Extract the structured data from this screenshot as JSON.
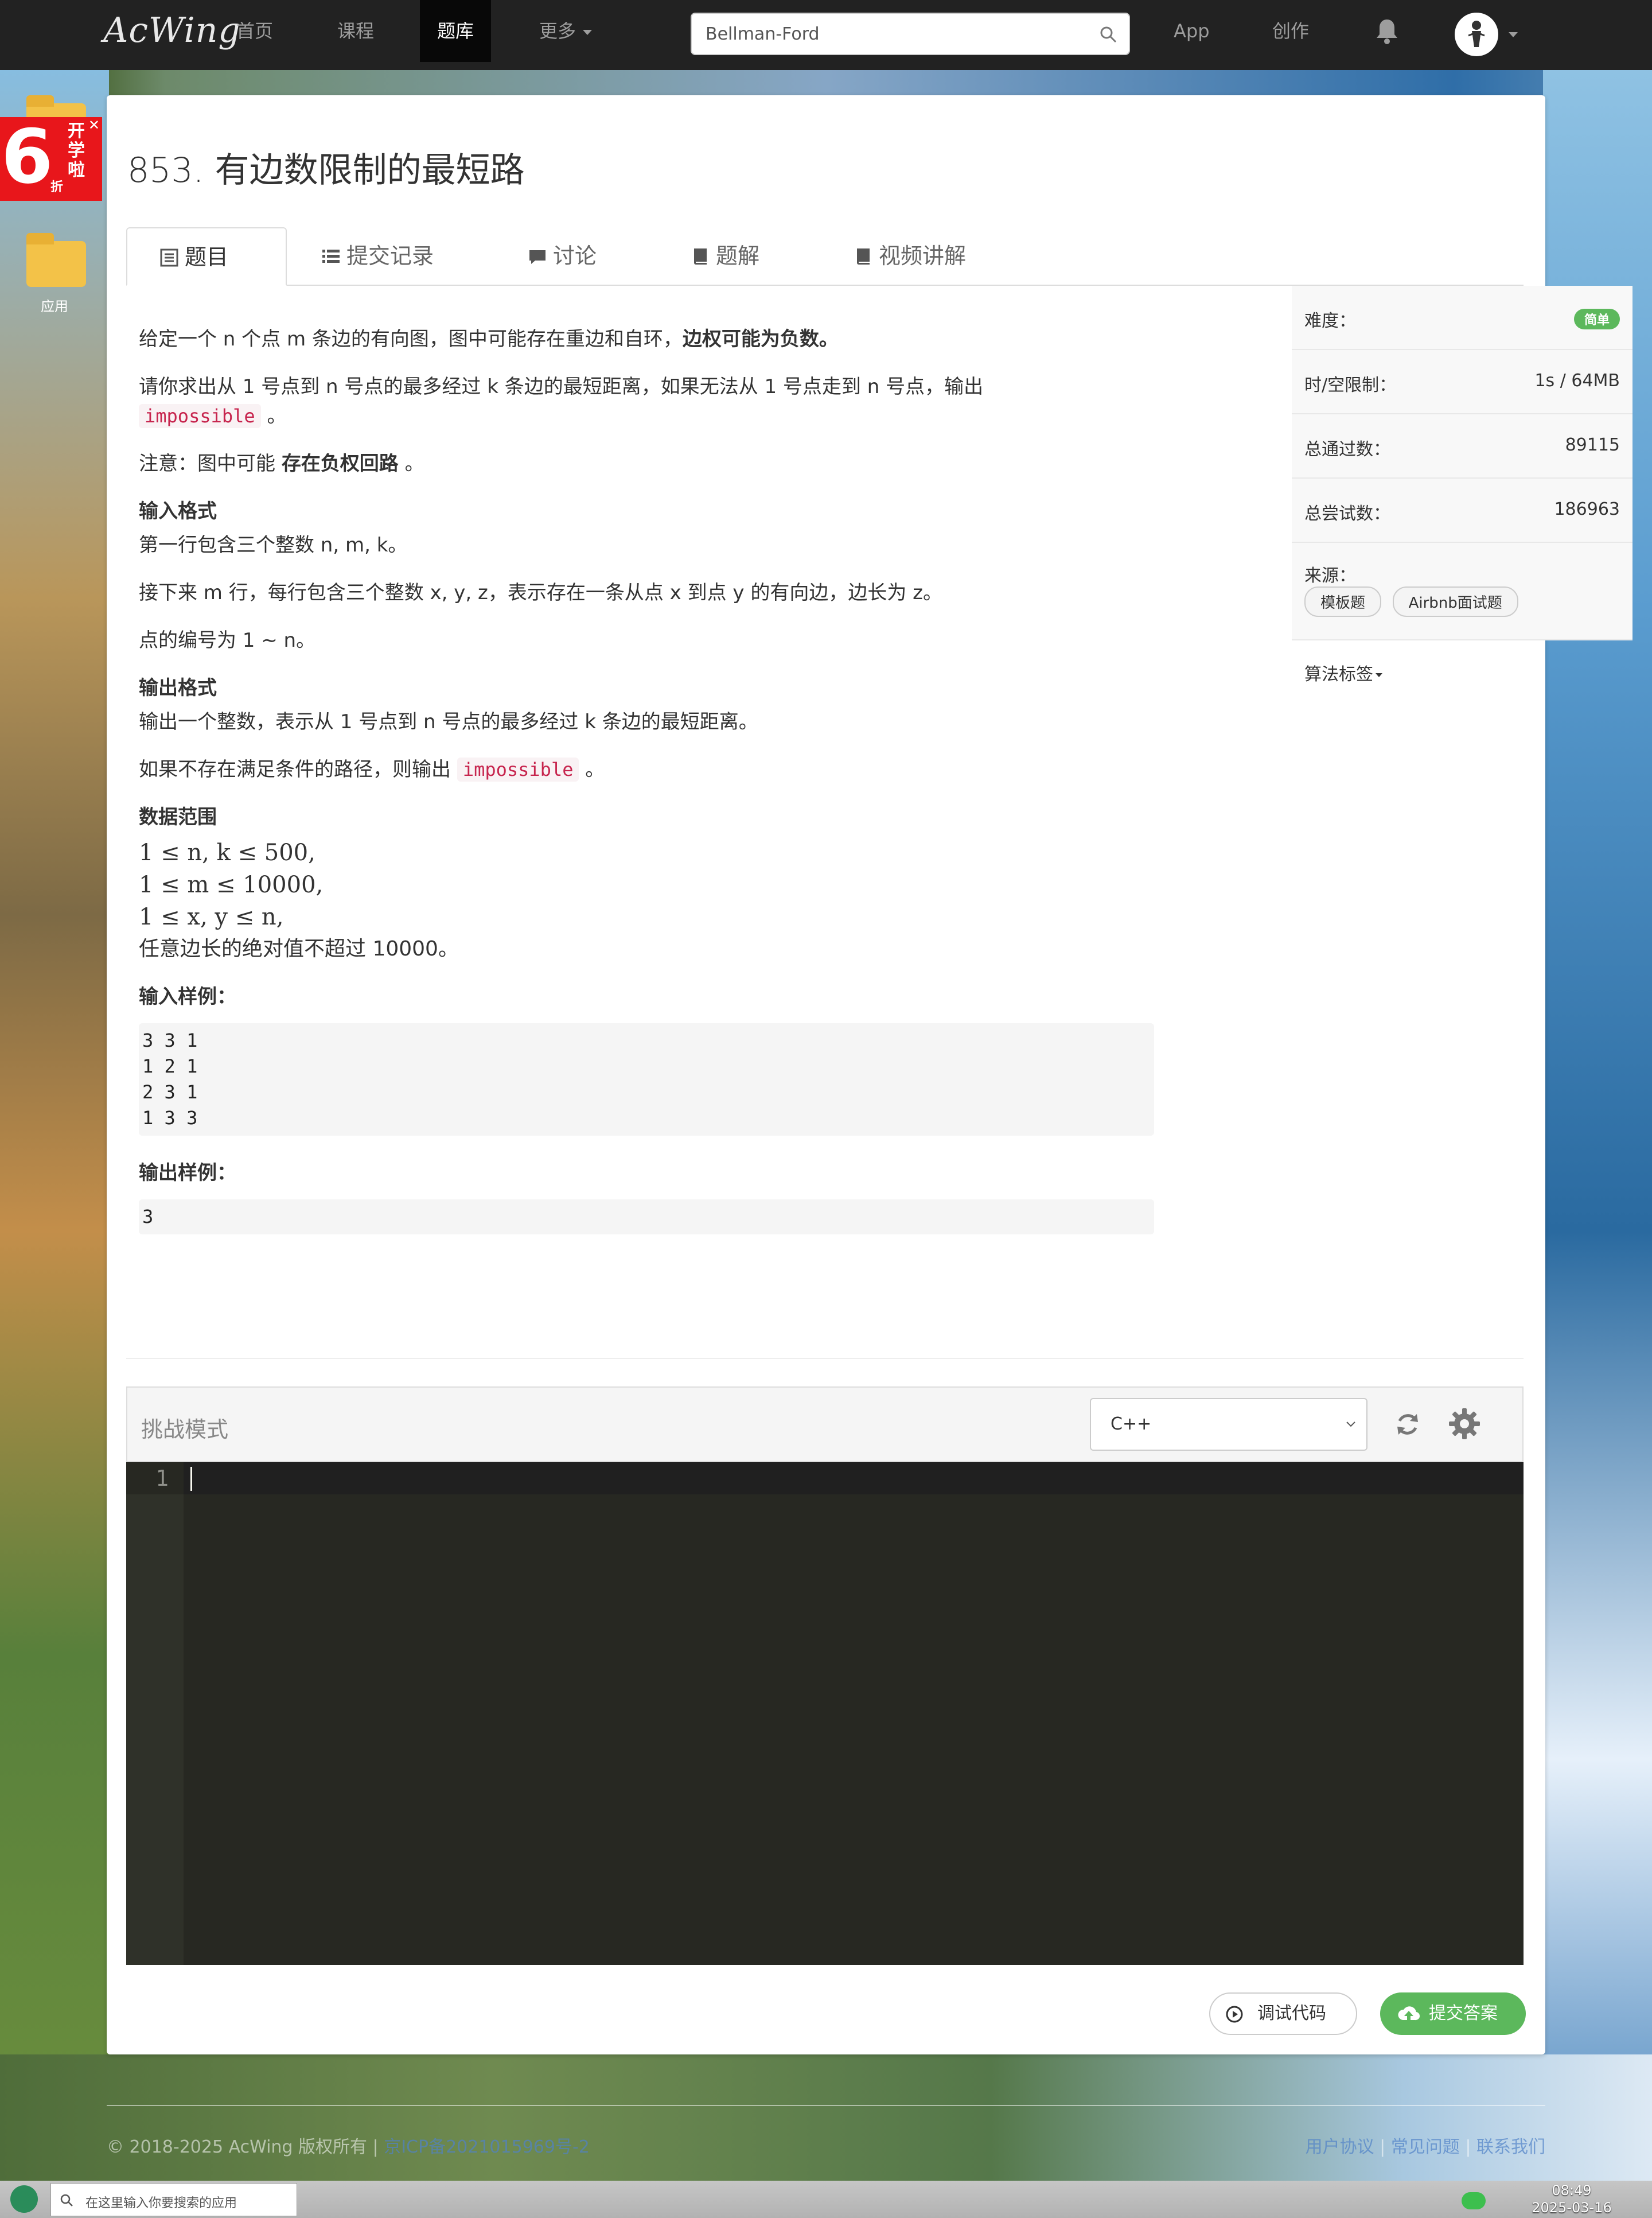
{
  "navbar": {
    "logo": "AcWing",
    "items": [
      "首页",
      "课程",
      "题库",
      "更多"
    ],
    "active": "题库",
    "search_value": "Bellman-Ford",
    "app": "App",
    "create": "创作"
  },
  "desktop": {
    "folder_label": "应用",
    "promo_number": "6",
    "promo_text": "开学啦",
    "promo_unit": "折"
  },
  "problem": {
    "title": "853. 有边数限制的最短路",
    "tabs": [
      "题目",
      "提交记录",
      "讨论",
      "题解",
      "视频讲解"
    ]
  },
  "description": {
    "p1_text": "给定一个 n 个点 m 条边的有向图，图中可能存在重边和自环，",
    "p1_bold": "边权可能为负数。",
    "p2_text": "请你求出从 1 号点到 n 号点的最多经过 k 条边的最短距离，如果无法从 1 号点走到 n 号点，输出",
    "p2_code": "impossible",
    "p2_end": "。",
    "p3_text": "注意：图中可能",
    "p3_bold": "存在负权回路",
    "p3_end": "。",
    "input_heading": "输入格式",
    "input_p1": "第一行包含三个整数 n, m, k。",
    "input_p2": "接下来 m 行，每行包含三个整数 x, y, z，表示存在一条从点 x 到点 y 的有向边，边长为 z。",
    "input_p3": "点的编号为 1 ∼ n。",
    "output_heading": "输出格式",
    "output_p1": "输出一个整数，表示从 1 号点到 n 号点的最多经过 k 条边的最短距离。",
    "output_p2_text": "如果不存在满足条件的路径，则输出",
    "output_p2_code": "impossible",
    "output_p2_end": "。",
    "range_heading": "数据范围",
    "range_lines": [
      "1 ≤ n, k ≤ 500,",
      "1 ≤ m ≤ 10000,",
      "1 ≤ x, y ≤ n,",
      "任意边长的绝对值不超过 10000。"
    ],
    "sample_in_heading": "输入样例：",
    "sample_in": [
      "3 3 1",
      "1 2 1",
      "2 3 1",
      "1 3 3"
    ],
    "sample_out_heading": "输出样例：",
    "sample_out": [
      "3"
    ]
  },
  "info": {
    "difficulty_label": "难度：",
    "difficulty_value": "简单",
    "limit_label": "时/空限制：",
    "limit_value": "1s / 64MB",
    "passed_label": "总通过数：",
    "passed_value": "89115",
    "tried_label": "总尝试数：",
    "tried_value": "186963",
    "source_label": "来源：",
    "source_tags": [
      "模板题",
      "Airbnb面试题"
    ],
    "algo_label": "算法标签"
  },
  "editor": {
    "mode": "挑战模式",
    "language": "C++",
    "line_number": "1",
    "debug_button": "调试代码",
    "submit_button": "提交答案"
  },
  "footer": {
    "left": "© 2018-2025 AcWing 版权所有  |  ",
    "left_link": "京ICP备2021015969号-2",
    "right_links": [
      "用户协议",
      "常见问题",
      "联系我们"
    ]
  },
  "taskbar": {
    "search_placeholder": "在这里输入你要搜索的应用",
    "time": "08:49",
    "date": "2025-03-16"
  },
  "colors": {
    "navbar": "#222222",
    "success": "#5cb85c",
    "inline_code": "#c7254e",
    "editor_bg": "#272822"
  }
}
